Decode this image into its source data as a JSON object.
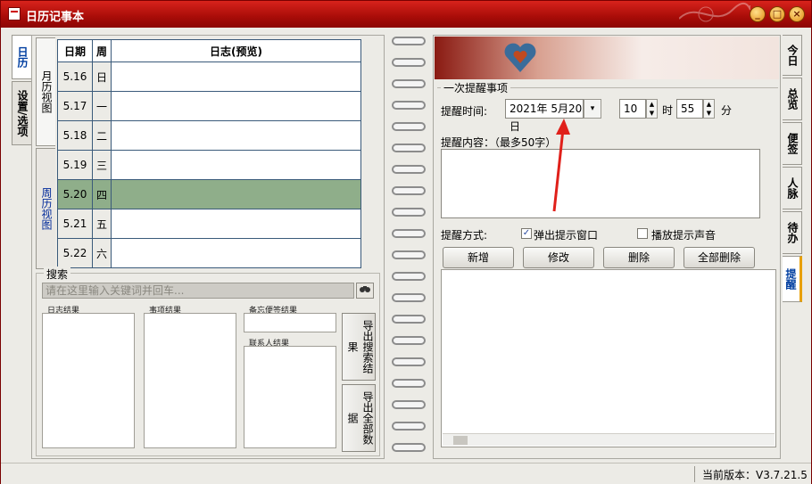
{
  "window": {
    "title": "日历记事本",
    "buttons": {
      "minimize": "_",
      "maximize": "□",
      "close": "×"
    }
  },
  "left_tabs": [
    {
      "label": "日历",
      "active": true
    },
    {
      "label": "设置/选项",
      "active": false
    }
  ],
  "view_tabs": [
    {
      "label": "月历视图"
    },
    {
      "label": "周历视图"
    }
  ],
  "day_table": {
    "headers": {
      "date": "日期",
      "weekday": "周",
      "journal": "日志(预览)"
    },
    "rows": [
      {
        "date": "5.16",
        "weekday": "日",
        "journal": ""
      },
      {
        "date": "5.17",
        "weekday": "一",
        "journal": ""
      },
      {
        "date": "5.18",
        "weekday": "二",
        "journal": ""
      },
      {
        "date": "5.19",
        "weekday": "三",
        "journal": ""
      },
      {
        "date": "5.20",
        "weekday": "四",
        "journal": "",
        "selected": true
      },
      {
        "date": "5.21",
        "weekday": "五",
        "journal": ""
      },
      {
        "date": "5.22",
        "weekday": "六",
        "journal": ""
      }
    ]
  },
  "search": {
    "label": "搜索",
    "placeholder": "请在这里输入关键词并回车...",
    "button_icon": "binoculars-icon",
    "results": {
      "journal": "日志结果",
      "items": "事项结果",
      "memo": "备忘便签结果",
      "contacts": "联系人结果"
    },
    "export_search": "导出搜索结果",
    "export_all": "导出全部数据"
  },
  "reminder": {
    "group_label": "一次提醒事项",
    "time_label": "提醒时间:",
    "date_value": "2021年  5月20日",
    "hour_value": "10",
    "hour_unit": "时",
    "minute_value": "55",
    "minute_unit": "分",
    "content_label": "提醒内容：（最多50字）",
    "content_value": "",
    "method_label": "提醒方式:",
    "popup_label": "弹出提示窗口",
    "popup_checked": true,
    "sound_label": "播放提示声音",
    "sound_checked": false,
    "buttons": {
      "add": "新增",
      "edit": "修改",
      "delete": "删除",
      "delete_all": "全部删除"
    }
  },
  "right_tabs": [
    {
      "label": "今日"
    },
    {
      "label": "总览"
    },
    {
      "label": "便签"
    },
    {
      "label": "人脉"
    },
    {
      "label": "待办"
    },
    {
      "label": "提醒",
      "active": true
    }
  ],
  "status": {
    "version": "当前版本：V3.7.21.5"
  },
  "colors": {
    "title_bar": "#b8140e",
    "selected_row": "#8fae8a",
    "active_tab_text": "#003ea0",
    "arrow": "#e0201a"
  }
}
